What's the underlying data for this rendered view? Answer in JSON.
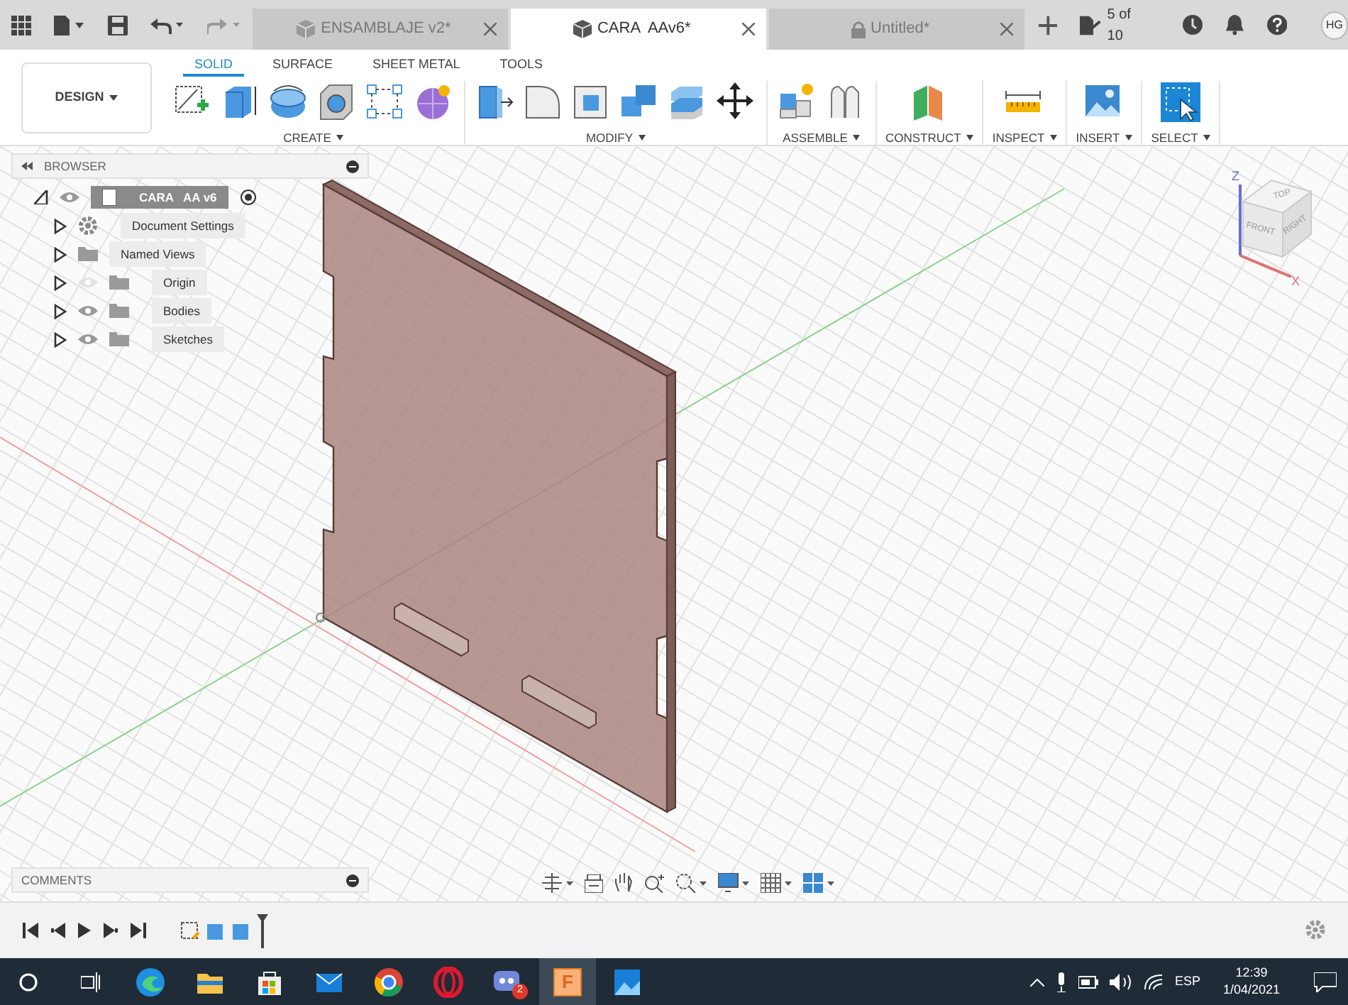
{
  "file_tabs": [
    {
      "label": "ENSAMBLAJE v2*",
      "kind": "part",
      "selected": false
    },
    {
      "label": "CARA  AAv6*",
      "kind": "part",
      "selected": true
    },
    {
      "label": "Untitled*",
      "kind": "locked",
      "selected": false
    }
  ],
  "job_status": "5 of 10",
  "user_initials": "HG",
  "workspace": "DESIGN",
  "toolbar_tabs": [
    {
      "label": "SOLID",
      "selected": true
    },
    {
      "label": "SURFACE",
      "selected": false
    },
    {
      "label": "SHEET METAL",
      "selected": false
    },
    {
      "label": "TOOLS",
      "selected": false
    }
  ],
  "tool_groups": [
    {
      "label": "CREATE",
      "tools": [
        {
          "kind": "sketch"
        },
        {
          "kind": "extrude"
        },
        {
          "kind": "revolve"
        },
        {
          "kind": "hole"
        },
        {
          "kind": "pattern"
        },
        {
          "kind": "form"
        }
      ]
    },
    {
      "label": "MODIFY",
      "tools": [
        {
          "kind": "presspull"
        },
        {
          "kind": "fillet"
        },
        {
          "kind": "shell"
        },
        {
          "kind": "combine"
        },
        {
          "kind": "stack"
        },
        {
          "kind": "move"
        }
      ]
    },
    {
      "label": "ASSEMBLE",
      "tools": [
        {
          "kind": "component"
        },
        {
          "kind": "joint"
        }
      ]
    },
    {
      "label": "CONSTRUCT",
      "tools": [
        {
          "kind": "plane"
        }
      ]
    },
    {
      "label": "INSPECT",
      "tools": [
        {
          "kind": "measure"
        }
      ]
    },
    {
      "label": "INSERT",
      "tools": [
        {
          "kind": "image"
        }
      ]
    },
    {
      "label": "SELECT",
      "tools": [
        {
          "kind": "select"
        }
      ]
    }
  ],
  "browser": {
    "title": "BROWSER",
    "root": {
      "label": "CARA   AA v6",
      "expanded": true,
      "children": [
        {
          "label": "Document Settings",
          "kind": "settings",
          "expanded": false
        },
        {
          "label": "Named Views",
          "kind": "views",
          "expanded": false
        },
        {
          "label": "Origin",
          "kind": "folder",
          "visible": false,
          "expanded": false
        },
        {
          "label": "Bodies",
          "kind": "folder",
          "visible": true,
          "expanded": false
        },
        {
          "label": "Sketches",
          "kind": "folder",
          "visible": true,
          "expanded": false
        }
      ]
    }
  },
  "view_cube": {
    "axis_z": "Z",
    "axis_x": "X",
    "top": "TOP",
    "front": "FRONT",
    "right": "RIGHT"
  },
  "comments": {
    "title": "COMMENTS"
  },
  "taskbar": {
    "apps": [
      {
        "kind": "edge",
        "active": false
      },
      {
        "kind": "explorer",
        "active": false
      },
      {
        "kind": "store",
        "active": false
      },
      {
        "kind": "mail",
        "active": false
      },
      {
        "kind": "chrome",
        "active": false
      },
      {
        "kind": "opera",
        "active": false
      },
      {
        "kind": "discord",
        "active": false,
        "badge": "2"
      },
      {
        "kind": "fusion",
        "active": true,
        "label": "F"
      },
      {
        "kind": "photos",
        "active": false
      }
    ],
    "language": "ESP",
    "time": "12:39",
    "date": "1/04/2021"
  }
}
